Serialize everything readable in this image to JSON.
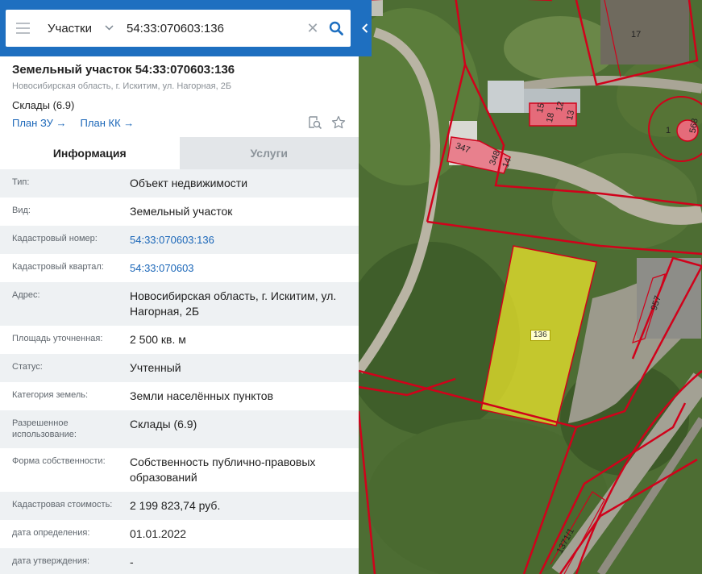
{
  "search": {
    "scope": "Участки",
    "query": "54:33:070603:136"
  },
  "object": {
    "title": "Земельный участок 54:33:070603:136",
    "address": "Новосибирская область, г. Искитим, ул. Нагорная, 2Б",
    "use": "Склады (6.9)",
    "link_plan_zu": "План ЗУ",
    "link_plan_kk": "План КК"
  },
  "tabs": {
    "info": "Информация",
    "services": "Услуги"
  },
  "rows": [
    {
      "label": "Тип:",
      "value": "Объект недвижимости"
    },
    {
      "label": "Вид:",
      "value": "Земельный участок"
    },
    {
      "label": "Кадастровый номер:",
      "value": "54:33:070603:136"
    },
    {
      "label": "Кадастровый квартал:",
      "value": "54:33:070603"
    },
    {
      "label": "Адрес:",
      "value": "Новосибирская область, г. Искитим, ул. Нагорная, 2Б"
    },
    {
      "label": "Площадь уточненная:",
      "value": "2 500 кв. м"
    },
    {
      "label": "Статус:",
      "value": "Учтенный"
    },
    {
      "label": "Категория земель:",
      "value": "Земли населённых пунктов"
    },
    {
      "label": "Разрешенное использование:",
      "value": "Склады (6.9)"
    },
    {
      "label": "Форма собственности:",
      "value": "Собственность публично-правовых образований"
    },
    {
      "label": "Кадастровая стоимость:",
      "value": "2 199 823,74 руб."
    },
    {
      "label": "дата определения:",
      "value": "01.01.2022"
    },
    {
      "label": "дата утверждения:",
      "value": "-"
    }
  ],
  "map": {
    "parcel_label": "136",
    "labels": [
      "17",
      "568",
      "1",
      "15",
      "18",
      "12",
      "13",
      "347",
      "348",
      "14",
      "957",
      "1371/1"
    ]
  },
  "colors": {
    "accent": "#1e6fc0",
    "link": "#1a66b8",
    "boundary": "#d0021b",
    "highlight": "#f2ea2b"
  }
}
